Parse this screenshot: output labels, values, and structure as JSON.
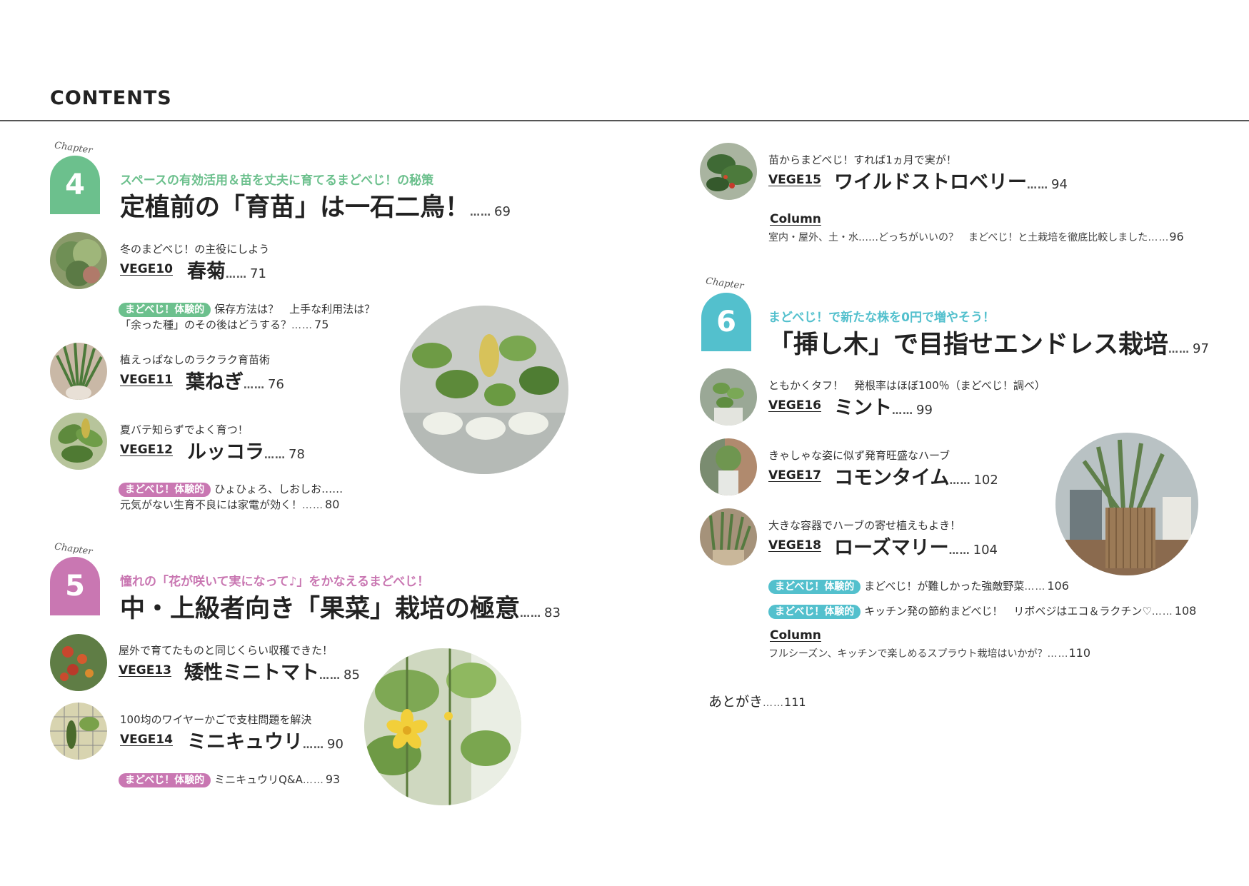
{
  "header": {
    "title": "CONTENTS"
  },
  "colors": {
    "green": "#6cc08d",
    "pink": "#c977b2",
    "cyan": "#53c0cd",
    "rule": "#555555"
  },
  "chapters": [
    {
      "script": "Chapter",
      "number": "4",
      "subtitle": "スペースの有効活用＆苗を丈夫に育てるまどべじ！の秘策",
      "title": "定植前の「育苗」は一石二鳥！",
      "page": "69"
    },
    {
      "script": "Chapter",
      "number": "5",
      "subtitle": "憧れの「花が咲いて実になって♪」をかなえるまどべじ！",
      "title": "中・上級者向き「果菜」栽培の極意",
      "page": "83"
    },
    {
      "script": "Chapter",
      "number": "6",
      "subtitle": "まどべじ！で新たな株を0円で増やそう！",
      "title": "「挿し木」で目指せエンドレス栽培",
      "page": "97"
    }
  ],
  "dots": "……",
  "veges": [
    {
      "sub": "冬のまどべじ！の主役にしよう",
      "code": "VEGE10",
      "title": "春菊",
      "page": "71"
    },
    {
      "sub": "植えっぱなしのラクラク育苗術",
      "code": "VEGE11",
      "title": "葉ねぎ",
      "page": "76"
    },
    {
      "sub": "夏バテ知らずでよく育つ！",
      "code": "VEGE12",
      "title": "ルッコラ",
      "page": "78"
    },
    {
      "sub": "屋外で育てたものと同じくらい収穫できた！",
      "code": "VEGE13",
      "title": "矮性ミニトマト",
      "page": "85"
    },
    {
      "sub": "100均のワイヤーかごで支柱問題を解決",
      "code": "VEGE14",
      "title": "ミニキュウリ",
      "page": "90"
    },
    {
      "sub": "苗からまどべじ！すれば1ヵ月で実が！",
      "code": "VEGE15",
      "title": "ワイルドストロベリー",
      "page": "94"
    },
    {
      "sub": "ともかくタフ！　発根率はほぼ100％（まどべじ！調べ）",
      "code": "VEGE16",
      "title": "ミント",
      "page": "99"
    },
    {
      "sub": "きゃしゃな姿に似ず発育旺盛なハーブ",
      "code": "VEGE17",
      "title": "コモンタイム",
      "page": "102"
    },
    {
      "sub": "大きな容器でハーブの寄せ植えもよき！",
      "code": "VEGE18",
      "title": "ローズマリー",
      "page": "104"
    }
  ],
  "experience_label": "まどべじ！体験的",
  "notes": [
    {
      "line1": "保存方法は？　上手な利用法は？",
      "line2": "「余った種」のその後はどうする？",
      "page": "75"
    },
    {
      "line1": "ひょひょろ、しおしお……",
      "line2": "元気がない生育不良には家電が効く！",
      "page": "80"
    },
    {
      "line1": "ミニキュウリQ&A",
      "page": "93"
    },
    {
      "line1": "まどべじ！が難しかった強敵野菜",
      "page": "106"
    },
    {
      "line1": "キッチン発の節約まどべじ！　リボベジはエコ＆ラクチン♡",
      "page": "108"
    }
  ],
  "columns": [
    {
      "label": "Column",
      "text": "室内・屋外、土・水……どっちがいいの？　まどべじ！と土栽培を徹底比較しました",
      "page": "96"
    },
    {
      "label": "Column",
      "text": "フルシーズン、キッチンで楽しめるスプラウト栽培はいかが？",
      "page": "110"
    }
  ],
  "afterword": {
    "label": "あとがき",
    "page": "111"
  }
}
